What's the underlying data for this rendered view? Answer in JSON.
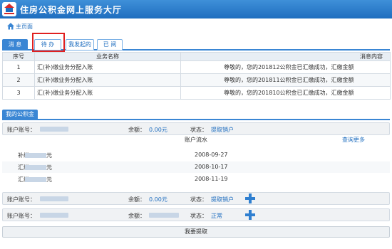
{
  "header": {
    "title": "住房公积金网上服务大厅"
  },
  "home": {
    "label": "主页面"
  },
  "tabs": [
    {
      "label": "消 息"
    },
    {
      "label": "待 办"
    },
    {
      "label": "我发起的"
    },
    {
      "label": "已 阅"
    }
  ],
  "messages": {
    "headers": [
      "序号",
      "业务名称",
      "消息内容"
    ],
    "rows": [
      {
        "no": "1",
        "name": "汇(补)缴业务分配入账",
        "content": "尊敬的，您的201812公积金已汇缴成功，汇缴金额"
      },
      {
        "no": "2",
        "name": "汇(补)缴业务分配入账",
        "content": "尊敬的，您的201811公积金已汇缴成功，汇缴金额"
      },
      {
        "no": "3",
        "name": "汇(补)缴业务分配入账",
        "content": "尊敬的，您的201810公积金已汇缴成功，汇缴金额"
      }
    ]
  },
  "fund": {
    "section_title": "我的公积金",
    "account_label": "账户账号：",
    "balance_label": "余额：",
    "status_label": "状态：",
    "accounts": [
      {
        "balance": "0.00元",
        "status": "提取销户"
      },
      {
        "balance": "0.00元",
        "status": "提取销户"
      },
      {
        "balance": "",
        "status": "正常"
      }
    ],
    "flow": {
      "title": "账户流水",
      "more": "查询更多",
      "unit": "元",
      "rows": [
        {
          "type": "补缴",
          "date": "2008-09-27"
        },
        {
          "type": "汇缴",
          "date": "2008-10-17"
        },
        {
          "type": "汇缴",
          "date": "2008-11-19"
        }
      ]
    },
    "extract_button": "我要提取"
  }
}
